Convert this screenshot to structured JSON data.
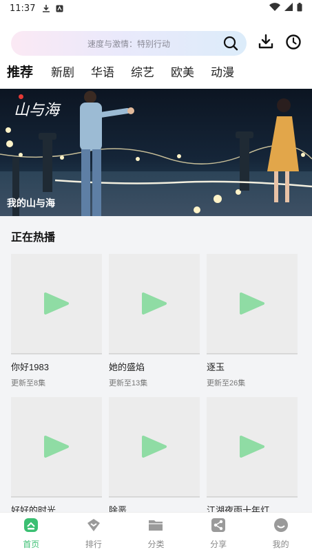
{
  "status_bar": {
    "time": "11:37"
  },
  "search": {
    "placeholder": "速度与激情：特别行动"
  },
  "tabs": [
    {
      "label": "推荐",
      "active": true
    },
    {
      "label": "新剧"
    },
    {
      "label": "华语"
    },
    {
      "label": "综艺"
    },
    {
      "label": "欧美"
    },
    {
      "label": "动漫"
    }
  ],
  "banner": {
    "title": "我的山与海",
    "poster_text": "山与海"
  },
  "section": {
    "title": "正在热播"
  },
  "cards": [
    {
      "title": "你好1983",
      "subtitle": "更新至8集"
    },
    {
      "title": "她的盛焰",
      "subtitle": "更新至13集"
    },
    {
      "title": "逐玉",
      "subtitle": "更新至26集"
    },
    {
      "title": "好好的时光",
      "subtitle": ""
    },
    {
      "title": "除恶",
      "subtitle": ""
    },
    {
      "title": "江湖夜雨十年灯",
      "subtitle": ""
    }
  ],
  "bottom_nav": [
    {
      "label": "首页",
      "icon": "home-icon",
      "active": true
    },
    {
      "label": "排行",
      "icon": "rank-icon"
    },
    {
      "label": "分类",
      "icon": "folder-icon"
    },
    {
      "label": "分享",
      "icon": "share-icon"
    },
    {
      "label": "我的",
      "icon": "profile-icon"
    }
  ],
  "colors": {
    "accent": "#3bbf72",
    "placeholder_play": "#8fdca4"
  }
}
